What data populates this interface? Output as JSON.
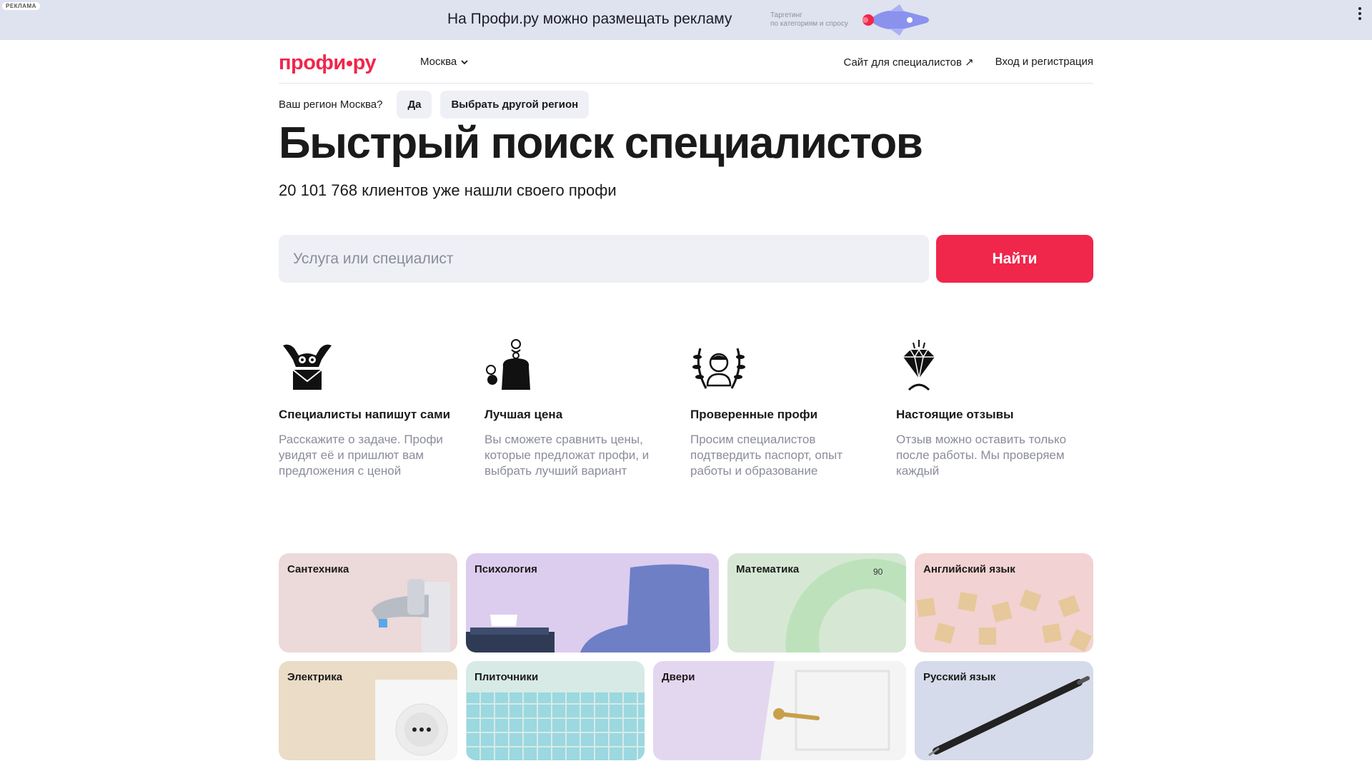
{
  "ad": {
    "label": "РЕКЛАМА",
    "text": "На Профи.ру можно размещать рекламу",
    "sub_line1": "Таргетинг",
    "sub_line2": "по категориям и спросу"
  },
  "header": {
    "logo_left": "профи",
    "logo_right": "ру",
    "city": "Москва",
    "nav": {
      "for_specialists": "Сайт для специалистов ↗",
      "login": "Вход и регистрация"
    }
  },
  "region": {
    "question": "Ваш регион Москва?",
    "yes": "Да",
    "other": "Выбрать другой регион"
  },
  "hero": {
    "title": "Быстрый поиск специалистов",
    "subtitle": "20 101 768 клиентов уже нашли своего профи"
  },
  "search": {
    "placeholder": "Услуга или специалист",
    "button": "Найти"
  },
  "features": [
    {
      "icon": "owl-envelope-icon",
      "title": "Специалисты напишут сами",
      "text": "Расскажите о задаче. Профи увидят её и пришлют вам предложения с ценой"
    },
    {
      "icon": "wallet-coins-icon",
      "title": "Лучшая цена",
      "text": "Вы сможете сравнить цены, которые предложат профи, и выбрать лучший вариант"
    },
    {
      "icon": "laurel-portrait-icon",
      "title": "Проверенные профи",
      "text": "Просим специалистов подтвердить паспорт, опыт работы и образование"
    },
    {
      "icon": "diamond-icon",
      "title": "Настоящие отзывы",
      "text": "Отзыв можно оставить только после работы. Мы проверяем каждый"
    }
  ],
  "categories": [
    {
      "label": "Сантехника",
      "color": "#ecd9d9"
    },
    {
      "label": "Психология",
      "color": "#dccdee"
    },
    {
      "label": "Математика",
      "color": "#d6e8d4"
    },
    {
      "label": "Английский язык",
      "color": "#f2d2d2"
    },
    {
      "label": "Электрика",
      "color": "#ebdcc7"
    },
    {
      "label": "Плиточники",
      "color": "#d7eae6"
    },
    {
      "label": "Двери",
      "color": "#e3d7ef"
    },
    {
      "label": "Русский язык",
      "color": "#d6dbeb"
    }
  ],
  "colors": {
    "brand": "#f0264b",
    "input_bg": "#eef0f6",
    "muted_text": "#8a8d99"
  }
}
